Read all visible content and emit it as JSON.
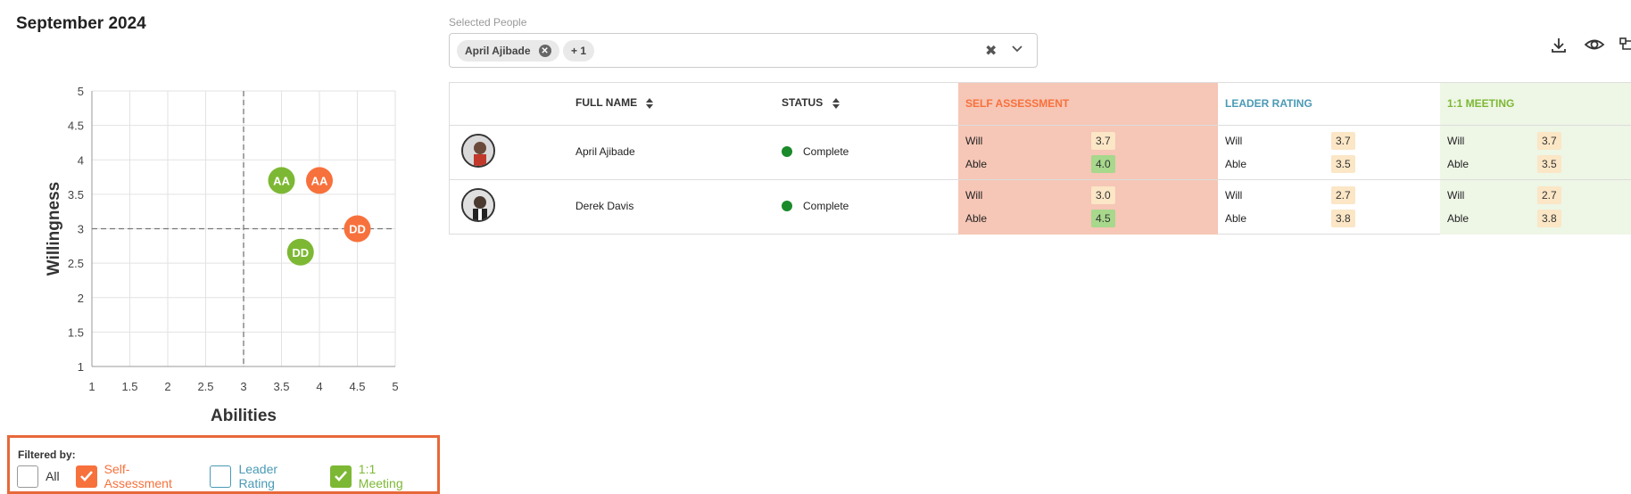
{
  "page_title": "September 2024",
  "colors": {
    "self": "#f7713c",
    "leader": "#4a9ab5",
    "meeting": "#7db834",
    "self_bg": "#f6c6b6",
    "meeting_bg": "#eef6e6",
    "score_bg": "#fbe6c6",
    "score_green_bg": "#a7d88c"
  },
  "chart_data": {
    "type": "scatter",
    "xlabel": "Abilities",
    "ylabel": "Willingness",
    "xlim": [
      1,
      5
    ],
    "ylim": [
      1,
      5
    ],
    "x_ticks": [
      "1",
      "1.5",
      "2",
      "2.5",
      "3",
      "3.5",
      "4",
      "4.5",
      "5"
    ],
    "y_ticks": [
      "1",
      "1.5",
      "2",
      "2.5",
      "3",
      "3.5",
      "4",
      "4.5",
      "5"
    ],
    "grid": true,
    "reference_lines": {
      "x": 3,
      "y": 3
    },
    "points": [
      {
        "label": "AA",
        "x": 3.5,
        "y": 3.7,
        "series": "1:1 Meeting"
      },
      {
        "label": "AA",
        "x": 4.0,
        "y": 3.7,
        "series": "Self-Assessment"
      },
      {
        "label": "DD",
        "x": 4.5,
        "y": 3.0,
        "series": "Self-Assessment"
      },
      {
        "label": "DD",
        "x": 3.75,
        "y": 2.66,
        "series": "1:1 Meeting"
      }
    ]
  },
  "filter": {
    "title": "Filtered by:",
    "options": [
      {
        "label": "All",
        "checked": false
      },
      {
        "label": "Self-Assessment",
        "checked": true
      },
      {
        "label": "Leader Rating",
        "checked": false
      },
      {
        "label": "1:1 Meeting",
        "checked": true
      }
    ]
  },
  "selector": {
    "label": "Selected People",
    "chip": "April Ajibade",
    "more": "+ 1"
  },
  "table": {
    "headers": {
      "full_name": "FULL NAME",
      "status": "STATUS",
      "self": "SELF ASSESSMENT",
      "leader": "LEADER RATING",
      "meeting": "1:1 MEETING"
    },
    "will_label": "Will",
    "able_label": "Able",
    "rows": [
      {
        "name": "April Ajibade",
        "status": "Complete",
        "self": {
          "will": "3.7",
          "able": "4.0"
        },
        "leader": {
          "will": "3.7",
          "able": "3.5"
        },
        "meeting": {
          "will": "3.7",
          "able": "3.5"
        }
      },
      {
        "name": "Derek Davis",
        "status": "Complete",
        "self": {
          "will": "3.0",
          "able": "4.5"
        },
        "leader": {
          "will": "2.7",
          "able": "3.8"
        },
        "meeting": {
          "will": "2.7",
          "able": "3.8"
        }
      }
    ]
  },
  "toolbar": {
    "icons": [
      "download-icon",
      "eye-icon",
      "hierarchy-icon"
    ]
  }
}
